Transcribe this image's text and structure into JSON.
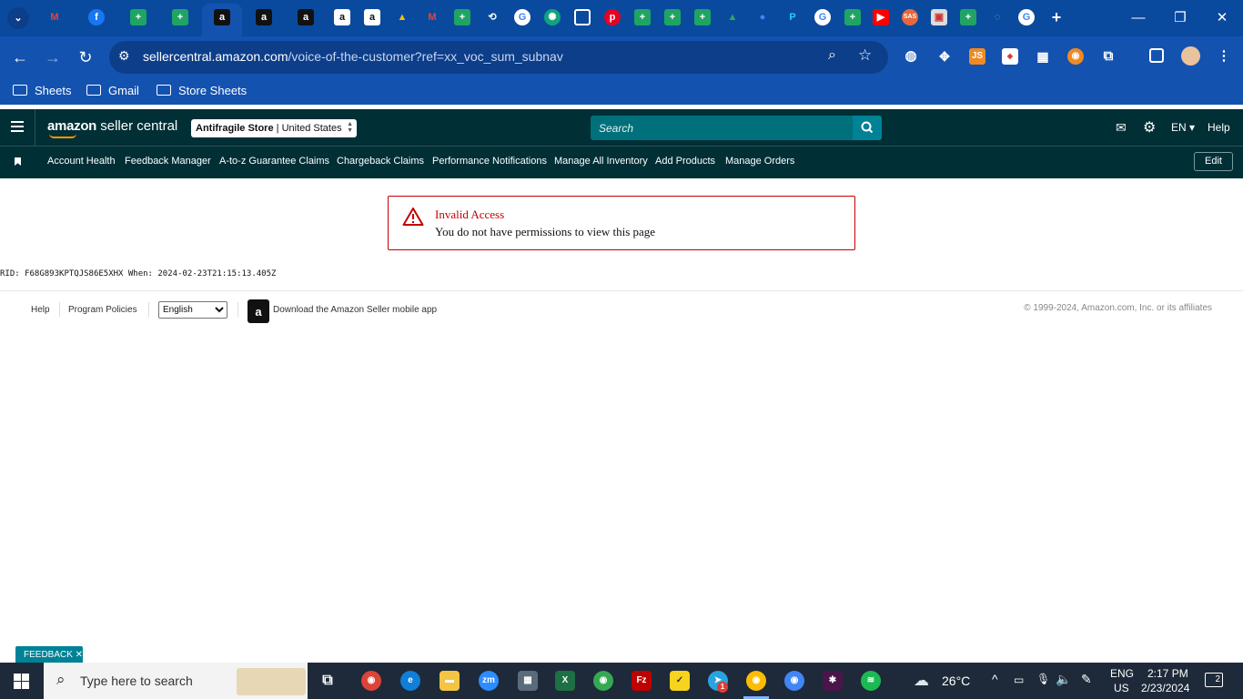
{
  "browser": {
    "url_host": "sellercentral.amazon.com",
    "url_path": "/voice-of-the-customer?ref=xx_voc_sum_subnav",
    "bookmarks": [
      "Sheets",
      "Gmail",
      "Store Sheets"
    ],
    "ext_js_label": "JS"
  },
  "header": {
    "logo_amazon": "amazon",
    "logo_rest": " seller central",
    "store_name": "Antifragile Store",
    "store_region": "United States",
    "search_placeholder": "Search",
    "language": "EN",
    "help": "Help"
  },
  "nav": {
    "links": [
      "Account Health",
      "Feedback Manager",
      "A-to-z Guarantee Claims",
      "Chargeback Claims",
      "Performance Notifications",
      "Manage All Inventory",
      "Add Products",
      "Manage Orders"
    ],
    "edit": "Edit"
  },
  "alert": {
    "title": "Invalid Access",
    "message": "You do not have permissions to view this page"
  },
  "rid_text": "RID: F68G893KPTQJS86E5XHX When: 2024-02-23T21:15:13.405Z",
  "footer": {
    "help": "Help",
    "program_policies": "Program Policies",
    "language_option": "English",
    "app_text": "Download the Amazon Seller mobile app",
    "copyright": "© 1999-2024, Amazon.com, Inc. or its affiliates"
  },
  "feedback_label": "FEEDBACK ✕",
  "taskbar": {
    "search_placeholder": "Type here to search",
    "temperature": "26°C",
    "lang_line1": "ENG",
    "lang_line2": "US",
    "time": "2:17 PM",
    "date": "2/23/2024",
    "notifications": "2",
    "telegram_badge": "1"
  },
  "colors": {
    "browser_frame": "#0a4a9e",
    "sc_header": "#002f36",
    "search_teal": "#00707a",
    "alert_red": "#c40000",
    "feedback_teal": "#008296"
  }
}
